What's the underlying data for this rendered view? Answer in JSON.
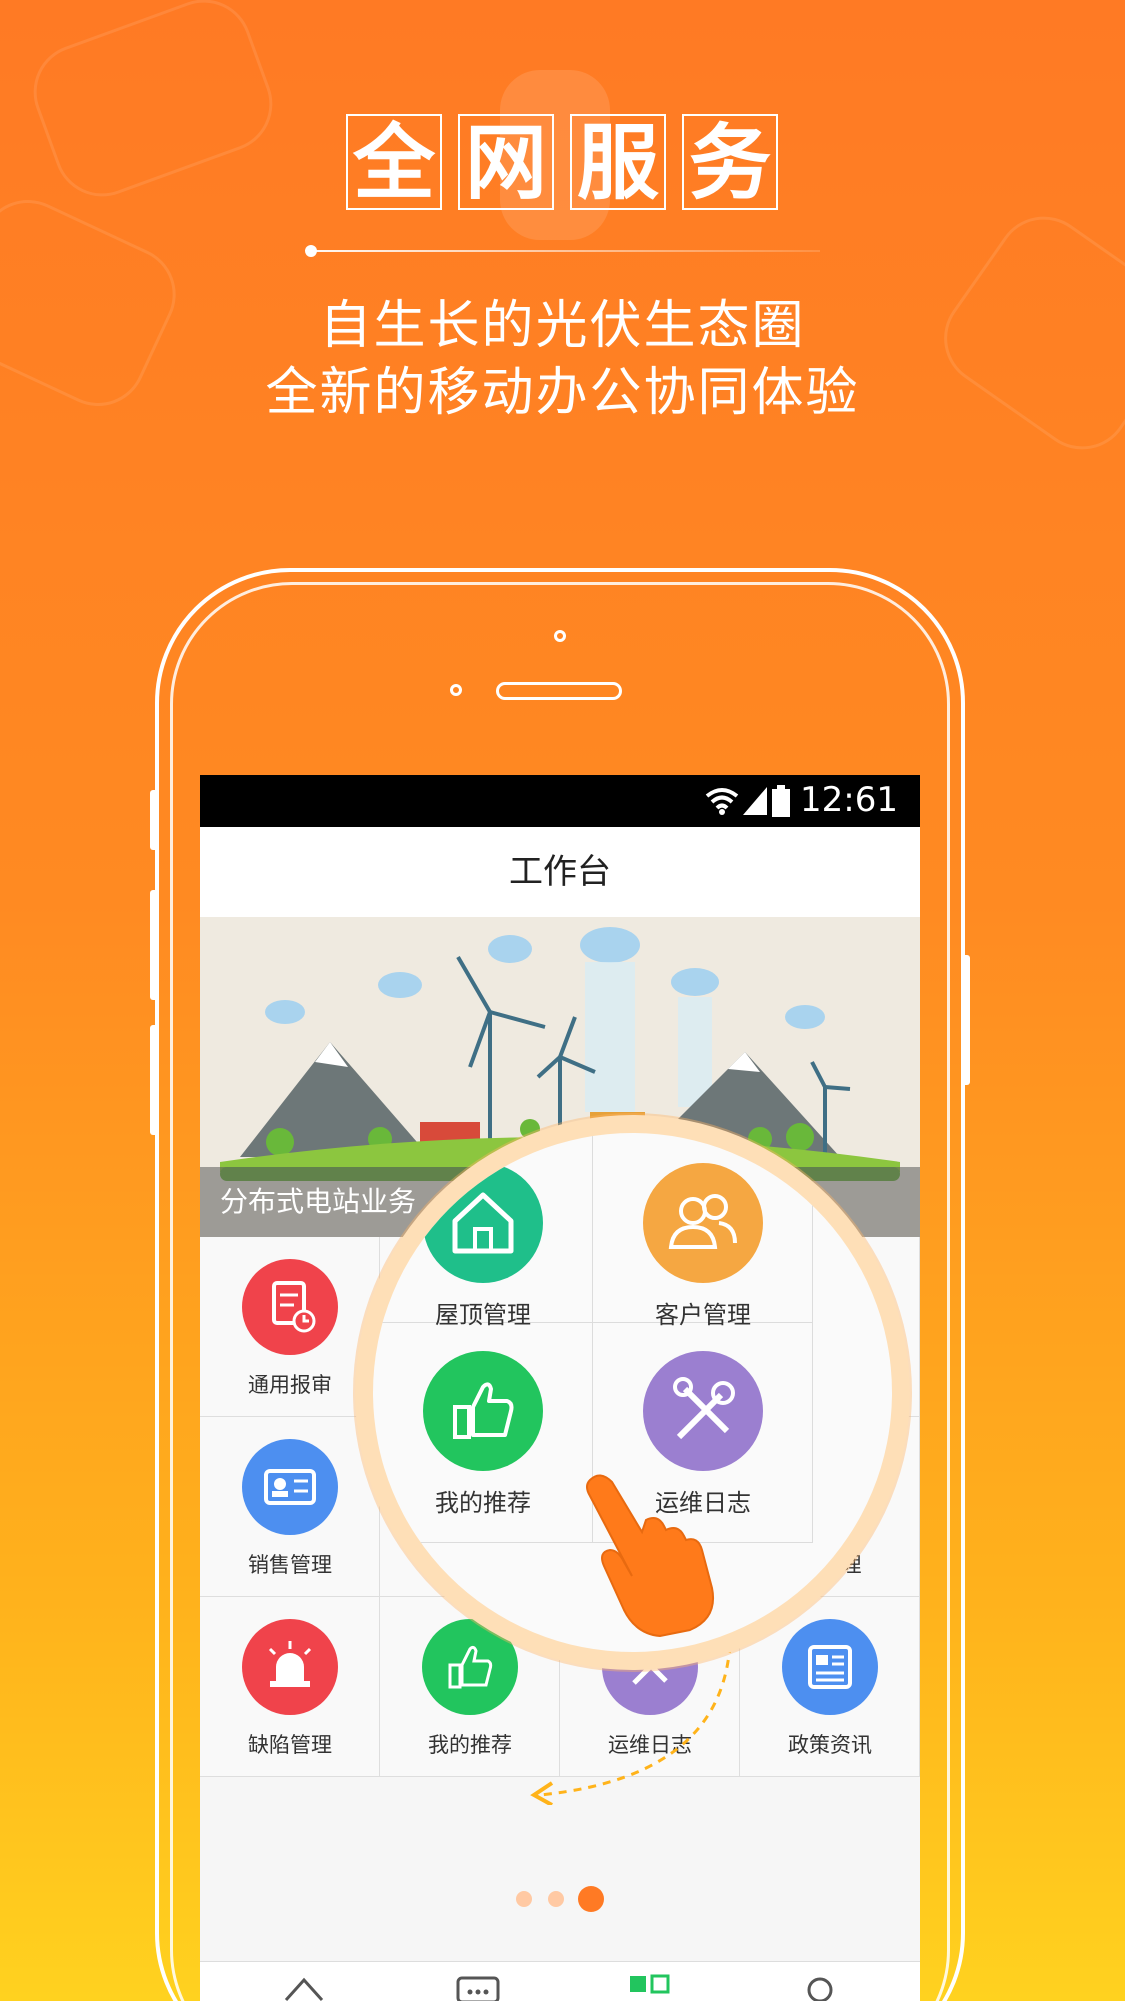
{
  "promo": {
    "title_chars": [
      "全",
      "网",
      "服",
      "务"
    ],
    "subtitle_line1": "自生长的光伏生态圈",
    "subtitle_line2": "全新的移动办公协同体验"
  },
  "status_bar": {
    "time": "12:61"
  },
  "app_bar": {
    "title": "工作台"
  },
  "banner": {
    "caption": "分布式电站业务"
  },
  "grid": {
    "row1": [
      {
        "label": "通用报审",
        "icon": "document-clock-icon",
        "color": "#f0434b"
      }
    ],
    "row2": [
      {
        "label": "销售管理",
        "icon": "id-card-icon",
        "color": "#4d8ff0"
      },
      {
        "label": "屋顶",
        "icon": "home-icon",
        "color": "#1fbf8a"
      },
      {
        "label": "单管理",
        "icon": "circle-icon",
        "color": "#1fbf9a"
      }
    ],
    "row3": [
      {
        "label": "缺陷管理",
        "icon": "alarm-light-icon",
        "color": "#f0434b"
      },
      {
        "label": "我的推荐",
        "icon": "thumbs-up-icon",
        "color": "#22c55e"
      },
      {
        "label": "运维日志",
        "icon": "tools-icon",
        "color": "#9b7fd0"
      },
      {
        "label": "政策资讯",
        "icon": "newspaper-icon",
        "color": "#4d8ff0"
      }
    ]
  },
  "magnifier": {
    "cells": [
      {
        "label": "屋顶管理",
        "icon": "home-icon",
        "color": "#1fbf8a"
      },
      {
        "label": "客户管理",
        "icon": "users-icon",
        "color": "#f5a742"
      },
      {
        "label": "我的推荐",
        "icon": "thumbs-up-icon",
        "color": "#22c55e"
      },
      {
        "label": "运维日志",
        "icon": "tools-icon",
        "color": "#9b7fd0"
      }
    ]
  },
  "pager": {
    "count": 3,
    "active": 3
  },
  "colors": {
    "accent_orange": "#ff8a22",
    "active_dot": "#ff7a24",
    "inactive_dot": "#ffc9a3",
    "nav_active": "#22c55e"
  }
}
